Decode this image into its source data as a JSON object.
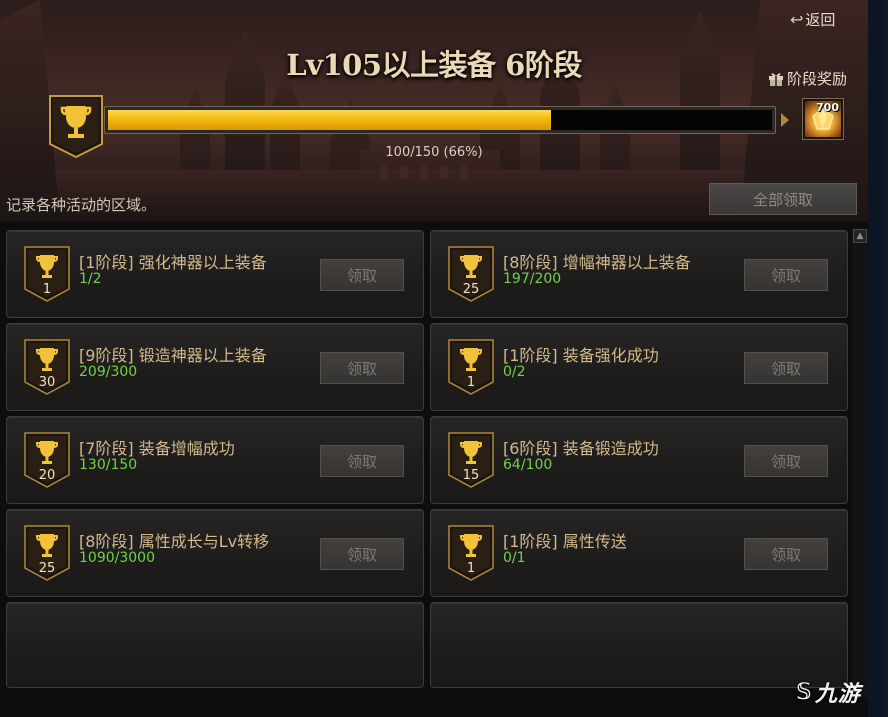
{
  "header": {
    "back_label": "返回",
    "title": "Lv105以上装备 6阶段",
    "stage_reward_label": "阶段奖励",
    "progress": {
      "current": 100,
      "max": 150,
      "percent": 66,
      "text": "100/150 (66%)"
    },
    "reward": {
      "count": "700",
      "icon": "gem-icon"
    },
    "description": "记录各种活动的区域。",
    "claim_all_label": "全部领取"
  },
  "achievements": [
    {
      "title": "[1阶段] 强化神器以上装备",
      "progress": "1/2",
      "level": "1",
      "claim_label": "领取"
    },
    {
      "title": "[8阶段] 增幅神器以上装备",
      "progress": "197/200",
      "level": "25",
      "claim_label": "领取"
    },
    {
      "title": "[9阶段] 锻造神器以上装备",
      "progress": "209/300",
      "level": "30",
      "claim_label": "领取"
    },
    {
      "title": "[1阶段] 装备强化成功",
      "progress": "0/2",
      "level": "1",
      "claim_label": "领取"
    },
    {
      "title": "[7阶段] 装备增幅成功",
      "progress": "130/150",
      "level": "20",
      "claim_label": "领取"
    },
    {
      "title": "[6阶段] 装备锻造成功",
      "progress": "64/100",
      "level": "15",
      "claim_label": "领取"
    },
    {
      "title": "[8阶段] 属性成长与Lv转移",
      "progress": "1090/3000",
      "level": "25",
      "claim_label": "领取"
    },
    {
      "title": "[1阶段] 属性传送",
      "progress": "0/1",
      "level": "1",
      "claim_label": "领取"
    }
  ],
  "watermark": "九游",
  "colors": {
    "gold": "#f5b80f",
    "progress_green": "#6fd24a",
    "title_tan": "#d3b98a"
  }
}
